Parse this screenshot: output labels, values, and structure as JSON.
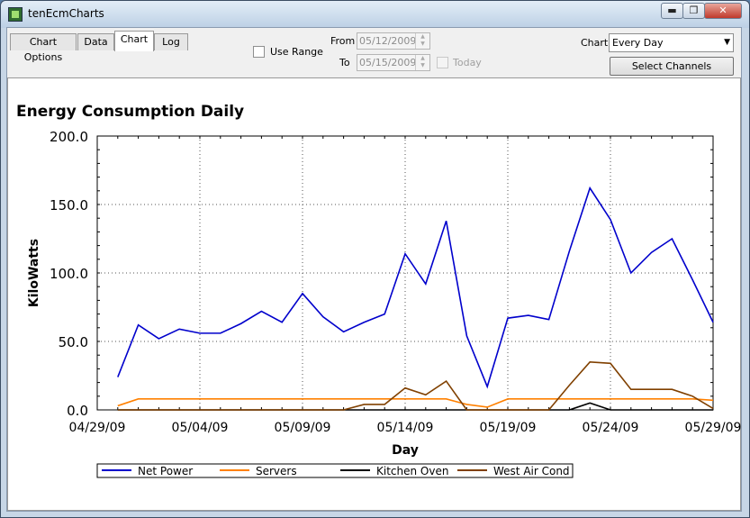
{
  "window": {
    "title": "tenEcmCharts",
    "min": "▬",
    "max": "❐",
    "close": "✕"
  },
  "tabs": [
    "Chart Options",
    "Data",
    "Chart",
    "Log"
  ],
  "active_tab": "Chart",
  "range": {
    "use_range_label": "Use Range",
    "from_label": "From",
    "from_value": "05/12/2009",
    "to_label": "To",
    "to_value": "05/15/2009",
    "today_label": "Today"
  },
  "chart_select": {
    "label": "Chart",
    "value": "Every Day"
  },
  "select_channels_label": "Select Channels",
  "colors": {
    "net_power": "#0000cc",
    "servers": "#ff8000",
    "kitchen_oven": "#000000",
    "west_air_cond": "#804000"
  },
  "chart_data": {
    "type": "line",
    "title": "Energy Consumption Daily",
    "xlabel": "Day",
    "ylabel": "KiloWatts",
    "ylim": [
      0,
      200
    ],
    "yticks": [
      "0.0",
      "50.0",
      "100.0",
      "150.0",
      "200.0"
    ],
    "xlim": [
      "2009-04-29",
      "2009-05-29"
    ],
    "xticks": [
      "04/29/09",
      "05/04/09",
      "05/09/09",
      "05/14/09",
      "05/19/09",
      "05/24/09",
      "05/29/09"
    ],
    "grid": true,
    "legend_position": "bottom",
    "x": [
      "2009-04-30",
      "2009-05-01",
      "2009-05-02",
      "2009-05-03",
      "2009-05-04",
      "2009-05-05",
      "2009-05-06",
      "2009-05-07",
      "2009-05-08",
      "2009-05-09",
      "2009-05-10",
      "2009-05-11",
      "2009-05-12",
      "2009-05-13",
      "2009-05-14",
      "2009-05-15",
      "2009-05-16",
      "2009-05-17",
      "2009-05-18",
      "2009-05-19",
      "2009-05-20",
      "2009-05-21",
      "2009-05-22",
      "2009-05-23",
      "2009-05-24",
      "2009-05-25",
      "2009-05-26",
      "2009-05-27",
      "2009-05-28",
      "2009-05-29"
    ],
    "series": [
      {
        "name": "Net Power",
        "values": [
          24,
          62,
          52,
          59,
          56,
          56,
          63,
          72,
          64,
          85,
          68,
          57,
          64,
          70,
          114,
          92,
          138,
          54,
          17,
          67,
          69,
          66,
          116,
          162,
          139,
          100,
          115,
          125,
          95,
          64
        ]
      },
      {
        "name": "Servers",
        "values": [
          3,
          8,
          8,
          8,
          8,
          8,
          8,
          8,
          8,
          8,
          8,
          8,
          8,
          8,
          8,
          8,
          8,
          4,
          2,
          8,
          8,
          8,
          8,
          8,
          8,
          8,
          8,
          8,
          8,
          7
        ]
      },
      {
        "name": "Kitchen Oven",
        "values": [
          0,
          0,
          0,
          0,
          0,
          0,
          0,
          0,
          0,
          0,
          0,
          0,
          0,
          0,
          0,
          0,
          0,
          0,
          0,
          0,
          0,
          0,
          0,
          5,
          0,
          0,
          0,
          0,
          0,
          0
        ]
      },
      {
        "name": "West Air Cond",
        "values": [
          0,
          0,
          0,
          0,
          0,
          0,
          0,
          0,
          0,
          0,
          0,
          0,
          4,
          4,
          16,
          11,
          21,
          0,
          0,
          0,
          0,
          0,
          18,
          35,
          34,
          15,
          15,
          15,
          10,
          1
        ]
      }
    ]
  }
}
